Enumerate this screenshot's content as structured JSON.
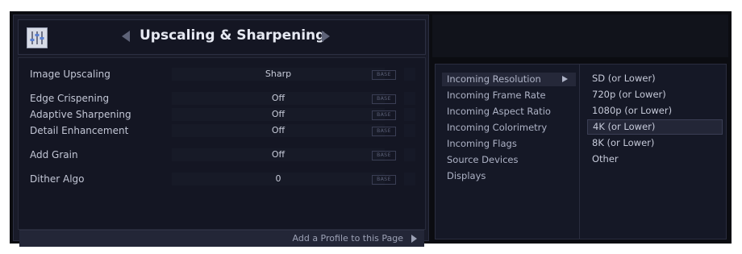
{
  "header": {
    "title": "Upscaling & Sharpening",
    "icon": "sliders-icon",
    "prev_icon": "triangle-left-icon",
    "next_icon": "triangle-right-icon"
  },
  "settings": [
    {
      "label": "Image Upscaling",
      "value": "Sharp",
      "badge": "BASE"
    },
    {
      "label": "Edge Crispening",
      "value": "Off",
      "badge": "BASE"
    },
    {
      "label": "Adaptive Sharpening",
      "value": "Off",
      "badge": "BASE"
    },
    {
      "label": "Detail Enhancement",
      "value": "Off",
      "badge": "BASE"
    },
    {
      "label": "Add Grain",
      "value": "Off",
      "badge": "BASE"
    },
    {
      "label": "Dither Algo",
      "value": "0",
      "badge": "BASE"
    }
  ],
  "footer": {
    "label": "Add a Profile to this Page"
  },
  "profile_menu": {
    "categories": [
      {
        "label": "Incoming Resolution",
        "selected": true
      },
      {
        "label": "Incoming Frame Rate",
        "selected": false
      },
      {
        "label": "Incoming Aspect Ratio",
        "selected": false
      },
      {
        "label": "Incoming Colorimetry",
        "selected": false
      },
      {
        "label": "Incoming Flags",
        "selected": false
      },
      {
        "label": "Source Devices",
        "selected": false
      },
      {
        "label": "Displays",
        "selected": false
      }
    ],
    "options": [
      {
        "label": "SD (or Lower)",
        "selected": false
      },
      {
        "label": "720p (or Lower)",
        "selected": false
      },
      {
        "label": "1080p (or Lower)",
        "selected": false
      },
      {
        "label": "4K (or Lower)",
        "selected": true
      },
      {
        "label": "8K (or Lower)",
        "selected": false
      },
      {
        "label": "Other",
        "selected": false
      }
    ]
  },
  "colors": {
    "panel_bg": "#191b29",
    "body_bg": "#141623",
    "text": "#c3c7d6",
    "title_text": "#e6e9f2"
  }
}
